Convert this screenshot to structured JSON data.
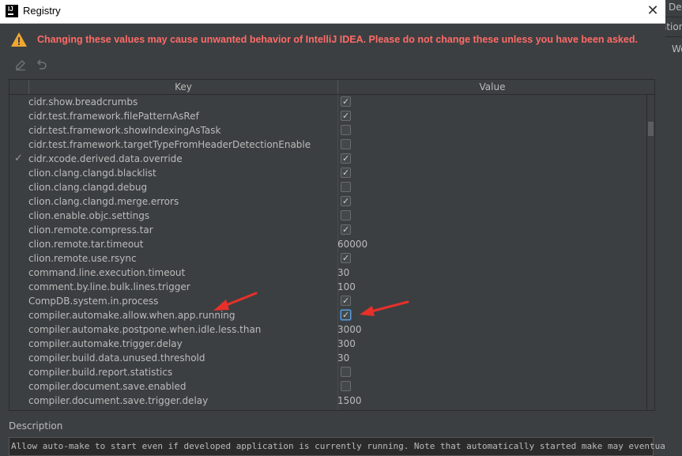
{
  "window": {
    "title": "Registry",
    "close_glyph": "✕"
  },
  "warning": {
    "icon": "warning-icon",
    "text": "Changing these values may cause unwanted behavior of IntelliJ IDEA. Please do not change these unless you have been asked."
  },
  "toolbar": {
    "edit_icon": "edit-icon",
    "revert_icon": "revert-icon"
  },
  "table": {
    "columns": [
      "Key",
      "Value"
    ],
    "rows": [
      {
        "key": "cidr.show.breadcrumbs",
        "type": "bool",
        "checked": true,
        "modified": false
      },
      {
        "key": "cidr.test.framework.filePatternAsRef",
        "type": "bool",
        "checked": true,
        "modified": false
      },
      {
        "key": "cidr.test.framework.showIndexingAsTask",
        "type": "bool",
        "checked": false,
        "modified": false
      },
      {
        "key": "cidr.test.framework.targetTypeFromHeaderDetectionEnable",
        "type": "bool",
        "checked": false,
        "modified": false
      },
      {
        "key": "cidr.xcode.derived.data.override",
        "type": "bool",
        "checked": true,
        "modified": true
      },
      {
        "key": "clion.clang.clangd.blacklist",
        "type": "bool",
        "checked": true,
        "modified": false
      },
      {
        "key": "clion.clang.clangd.debug",
        "type": "bool",
        "checked": false,
        "modified": false
      },
      {
        "key": "clion.clang.clangd.merge.errors",
        "type": "bool",
        "checked": true,
        "modified": false
      },
      {
        "key": "clion.enable.objc.settings",
        "type": "bool",
        "checked": false,
        "modified": false
      },
      {
        "key": "clion.remote.compress.tar",
        "type": "bool",
        "checked": true,
        "modified": false
      },
      {
        "key": "clion.remote.tar.timeout",
        "type": "text",
        "value": "60000",
        "modified": false
      },
      {
        "key": "clion.remote.use.rsync",
        "type": "bool",
        "checked": true,
        "modified": false
      },
      {
        "key": "command.line.execution.timeout",
        "type": "text",
        "value": "30",
        "modified": false
      },
      {
        "key": "comment.by.line.bulk.lines.trigger",
        "type": "text",
        "value": "100",
        "modified": false
      },
      {
        "key": "CompDB.system.in.process",
        "type": "bool",
        "checked": true,
        "modified": false
      },
      {
        "key": "compiler.automake.allow.when.app.running",
        "type": "bool",
        "checked": true,
        "modified": false,
        "focused": true
      },
      {
        "key": "compiler.automake.postpone.when.idle.less.than",
        "type": "text",
        "value": "3000",
        "modified": false
      },
      {
        "key": "compiler.automake.trigger.delay",
        "type": "text",
        "value": "300",
        "modified": false
      },
      {
        "key": "compiler.build.data.unused.threshold",
        "type": "text",
        "value": "30",
        "modified": false
      },
      {
        "key": "compiler.build.report.statistics",
        "type": "bool",
        "checked": false,
        "modified": false
      },
      {
        "key": "compiler.document.save.enabled",
        "type": "bool",
        "checked": false,
        "modified": false
      },
      {
        "key": "compiler.document.save.trigger.delay",
        "type": "text",
        "value": "1500",
        "modified": false
      }
    ]
  },
  "description": {
    "label": "Description",
    "text": "Allow auto-make to start even if developed application is currently running. Note that automatically started make may eventually delete"
  },
  "background_ide": {
    "top_text": "De",
    "second_text": "ation",
    "third_text": "Wo"
  },
  "colors": {
    "warning": "#ff6b68",
    "annotation_arrow": "#e8302a",
    "focus": "#5d9ddc"
  }
}
